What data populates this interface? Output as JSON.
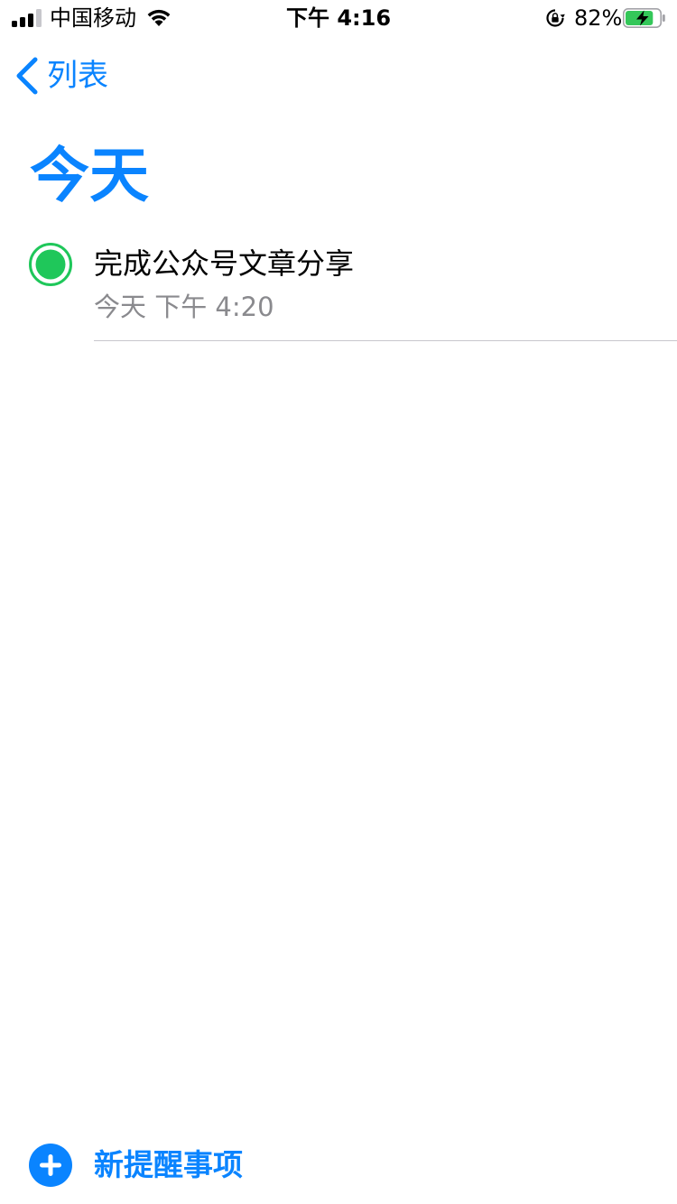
{
  "status_bar": {
    "carrier": "中国移动",
    "time": "下午 4:16",
    "battery_percent": "82%",
    "battery_level": 0.82,
    "icons": [
      "signal-icon",
      "wifi-icon",
      "rotation-lock-icon",
      "battery-charging-icon"
    ]
  },
  "nav": {
    "back_label": "列表"
  },
  "page": {
    "title": "今天"
  },
  "reminders": [
    {
      "title": "完成公众号文章分享",
      "due": "今天 下午 4:20",
      "flag_color": "#1fc75a"
    }
  ],
  "footer": {
    "new_reminder_label": "新提醒事项"
  },
  "colors": {
    "accent": "#0a84ff",
    "secondary_text": "#8a8a8e",
    "reminder_circle": "#1fc75a",
    "battery_fill": "#34c759"
  }
}
